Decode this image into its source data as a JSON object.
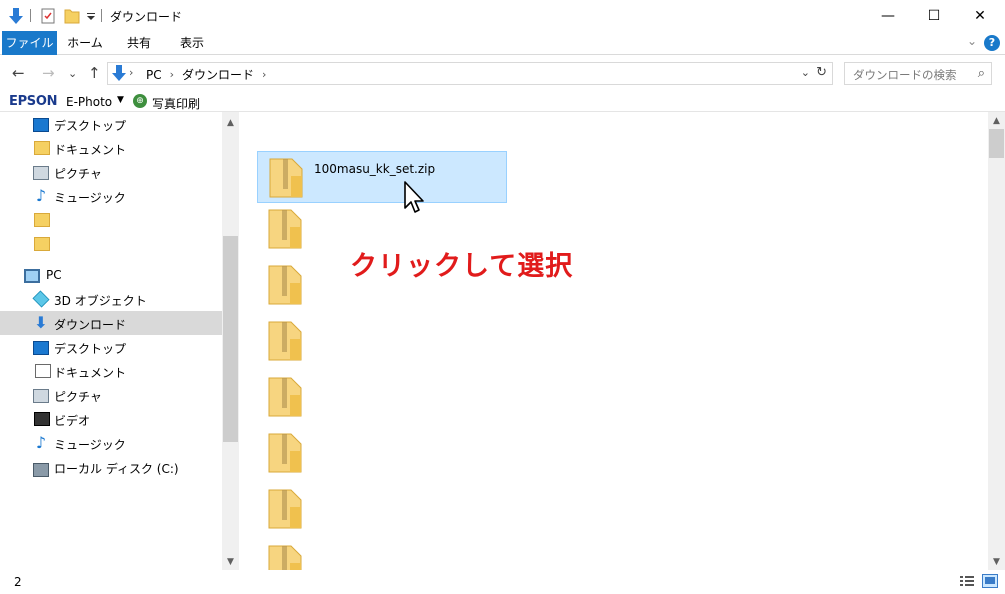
{
  "titlebar": {
    "title": "ダウンロード",
    "controls": {
      "minimize": "—",
      "maximize": "☐",
      "close": "✕"
    }
  },
  "ribbon": {
    "tabs": [
      "ファイル",
      "ホーム",
      "共有",
      "表示"
    ],
    "help": "?",
    "collapse": "⌄"
  },
  "nav": {
    "back": "←",
    "forward": "→",
    "recent": "⌄",
    "up": "↑",
    "breadcrumbs": [
      "PC",
      "ダウンロード"
    ],
    "dropdown": "⌄",
    "refresh": "↻",
    "search_placeholder": "ダウンロードの検索",
    "search_icon": "⌕"
  },
  "epson": {
    "logo": "EPSON",
    "app": "E-Photo",
    "caret": "▼",
    "print_label": "写真印刷"
  },
  "sidebar": {
    "items": [
      {
        "label": "デスクトップ",
        "icon": "desktop-icon"
      },
      {
        "label": "ドキュメント",
        "icon": "folder-icon"
      },
      {
        "label": "ピクチャ",
        "icon": "pictures-icon"
      },
      {
        "label": "ミュージック",
        "icon": "music-icon"
      },
      {
        "label": "",
        "icon": "folder-icon"
      },
      {
        "label": "",
        "icon": "folder-icon"
      },
      {
        "label": "PC",
        "icon": "pc-icon"
      },
      {
        "label": "3D オブジェクト",
        "icon": "3d-objects-icon"
      },
      {
        "label": "ダウンロード",
        "icon": "download-icon",
        "selected": true
      },
      {
        "label": "デスクトップ",
        "icon": "desktop-icon"
      },
      {
        "label": "ドキュメント",
        "icon": "document-icon"
      },
      {
        "label": "ピクチャ",
        "icon": "pictures-icon"
      },
      {
        "label": "ビデオ",
        "icon": "video-icon"
      },
      {
        "label": "ミュージック",
        "icon": "music-icon"
      },
      {
        "label": "ローカル ディスク (C:)",
        "icon": "drive-icon"
      }
    ]
  },
  "files": [
    {
      "name": "100masu_kk_set.zip",
      "selected": true
    },
    {
      "name": ""
    },
    {
      "name": ""
    },
    {
      "name": ""
    },
    {
      "name": ""
    },
    {
      "name": ""
    },
    {
      "name": ""
    },
    {
      "name": ""
    }
  ],
  "annotation": "クリックして選択",
  "status": {
    "count": "2"
  },
  "colors": {
    "accent": "#1979ca",
    "selection": "#cce8ff",
    "annotation": "#e11b1b"
  }
}
